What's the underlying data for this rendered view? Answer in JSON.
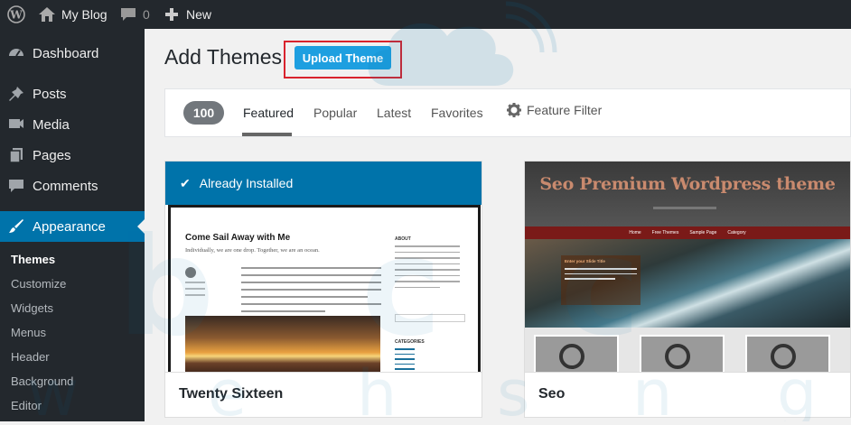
{
  "adminbar": {
    "site_name": "My Blog",
    "comments_count": "0",
    "new_label": "New"
  },
  "sidebar": {
    "items": [
      {
        "label": "Dashboard"
      },
      {
        "label": "Posts"
      },
      {
        "label": "Media"
      },
      {
        "label": "Pages"
      },
      {
        "label": "Comments"
      },
      {
        "label": "Appearance"
      }
    ],
    "submenu": [
      "Themes",
      "Customize",
      "Widgets",
      "Menus",
      "Header",
      "Background",
      "Editor"
    ]
  },
  "page": {
    "title": "Add Themes",
    "upload_button": "Upload Theme"
  },
  "filter": {
    "count": "100",
    "tabs": [
      "Featured",
      "Popular",
      "Latest",
      "Favorites"
    ],
    "feature_filter": "Feature Filter"
  },
  "themes": [
    {
      "name": "Twenty Sixteen",
      "installed_label": "Already Installed",
      "preview": {
        "post_title": "Come Sail Away with Me",
        "tagline": "Individually, we are one drop. Together, we are an ocean.",
        "about_heading": "ABOUT",
        "categories_heading": "CATEGORIES"
      }
    },
    {
      "name": "Seo",
      "preview": {
        "title": "Seo Premium Wordpress theme",
        "nav": [
          "Home",
          "Free Themes",
          "Sample Page",
          "Category"
        ],
        "slide_title": "Enter your Slide Title"
      }
    }
  ],
  "colors": {
    "accent": "#0073aa",
    "adminbar": "#23282d",
    "highlight": "#d9232d",
    "button": "#1e9fe0"
  }
}
